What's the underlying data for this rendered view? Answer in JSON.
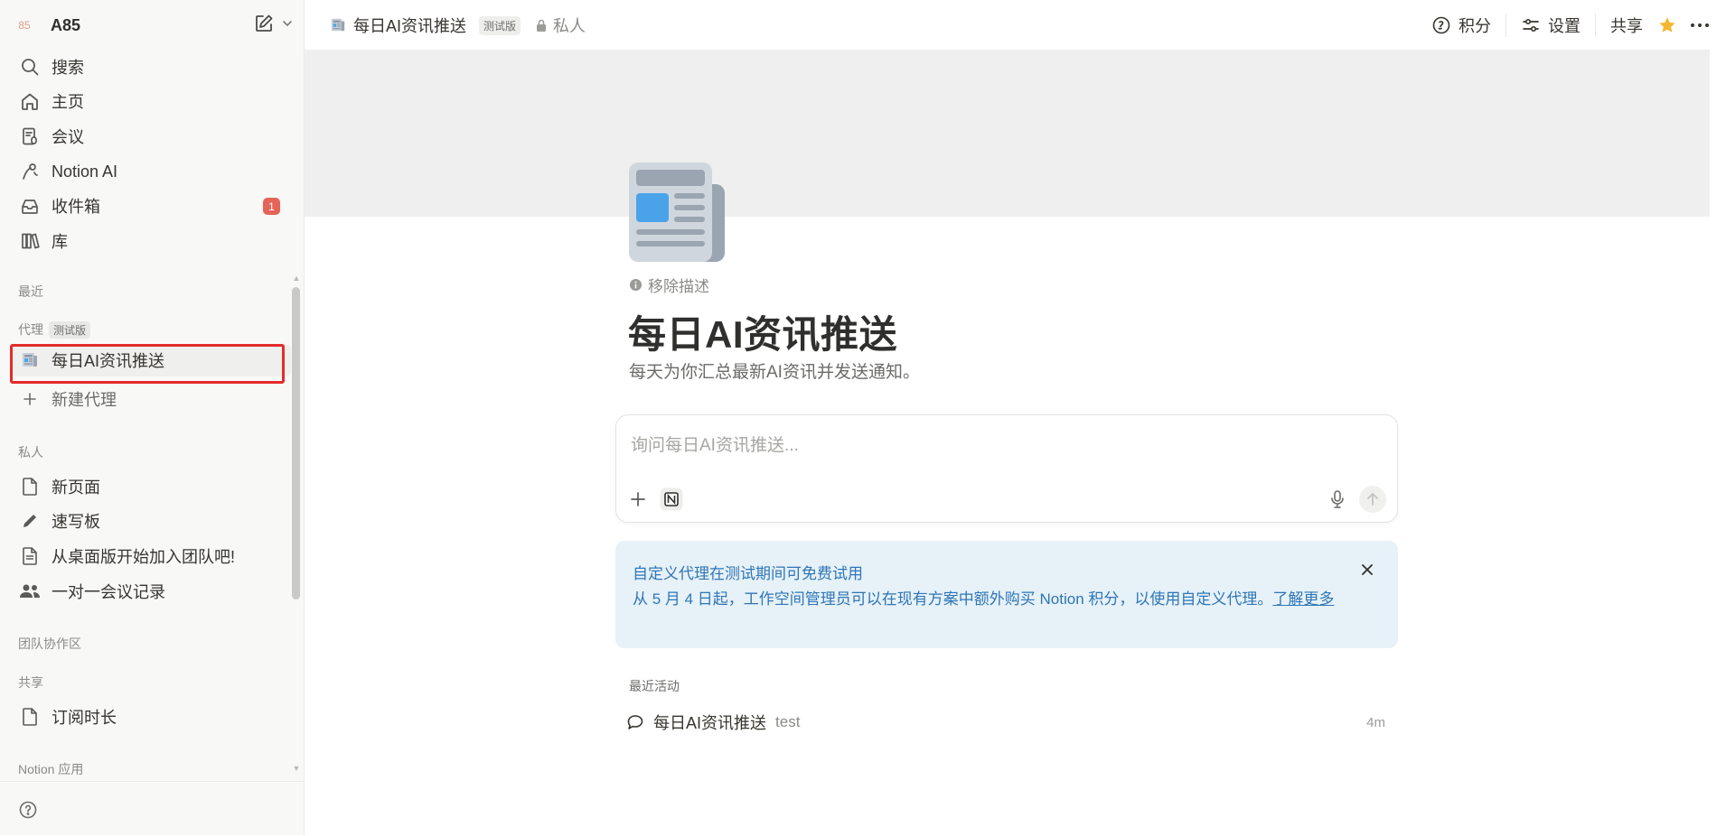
{
  "sidebar": {
    "workspace": {
      "logo": "85",
      "name": "A85"
    },
    "nav": [
      {
        "icon": "search-icon",
        "label": "搜索"
      },
      {
        "icon": "home-icon",
        "label": "主页"
      },
      {
        "icon": "meeting-icon",
        "label": "会议"
      },
      {
        "icon": "notion-ai-icon",
        "label": "Notion AI"
      },
      {
        "icon": "inbox-icon",
        "label": "收件箱",
        "badge": "1"
      },
      {
        "icon": "library-icon",
        "label": "库"
      }
    ],
    "recent_label": "最近",
    "agents_label": "代理",
    "agents_beta": "测试版",
    "agent_item": "每日AI资讯推送",
    "new_agent": "新建代理",
    "private_label": "私人",
    "private_items": [
      {
        "icon": "page-icon",
        "label": "新页面"
      },
      {
        "icon": "pencil-icon",
        "label": "速写板"
      },
      {
        "icon": "page-icon",
        "label": "从桌面版开始加入团队吧!"
      },
      {
        "icon": "people-icon",
        "label": "一对一会议记录"
      }
    ],
    "team_label": "团队协作区",
    "shared_label": "共享",
    "shared_items": [
      {
        "icon": "page-icon",
        "label": "订阅时长"
      }
    ],
    "apps_label": "Notion 应用"
  },
  "topbar": {
    "title": "每日AI资讯推送",
    "beta": "测试版",
    "privacy": "私人",
    "credits": "积分",
    "settings": "设置",
    "share": "共享"
  },
  "page": {
    "remove_description": "移除描述",
    "title": "每日AI资讯推送",
    "description": "每天为你汇总最新AI资讯并发送通知。",
    "chat_placeholder": "询问每日AI资讯推送..."
  },
  "notice": {
    "title": "自定义代理在测试期间可免费试用",
    "body": "从 5 月 4 日起，工作空间管理员可以在现有方案中额外购买 Notion 积分，以使用自定义代理。",
    "link": "了解更多"
  },
  "activity": {
    "label": "最近活动",
    "items": [
      {
        "name": "每日AI资讯推送",
        "detail": "test",
        "time": "4m"
      }
    ]
  },
  "colors": {
    "accent_blue": "#2f76b6",
    "badge_red": "#e56458",
    "highlight_red": "#e32b2b",
    "star": "#f5b731"
  }
}
